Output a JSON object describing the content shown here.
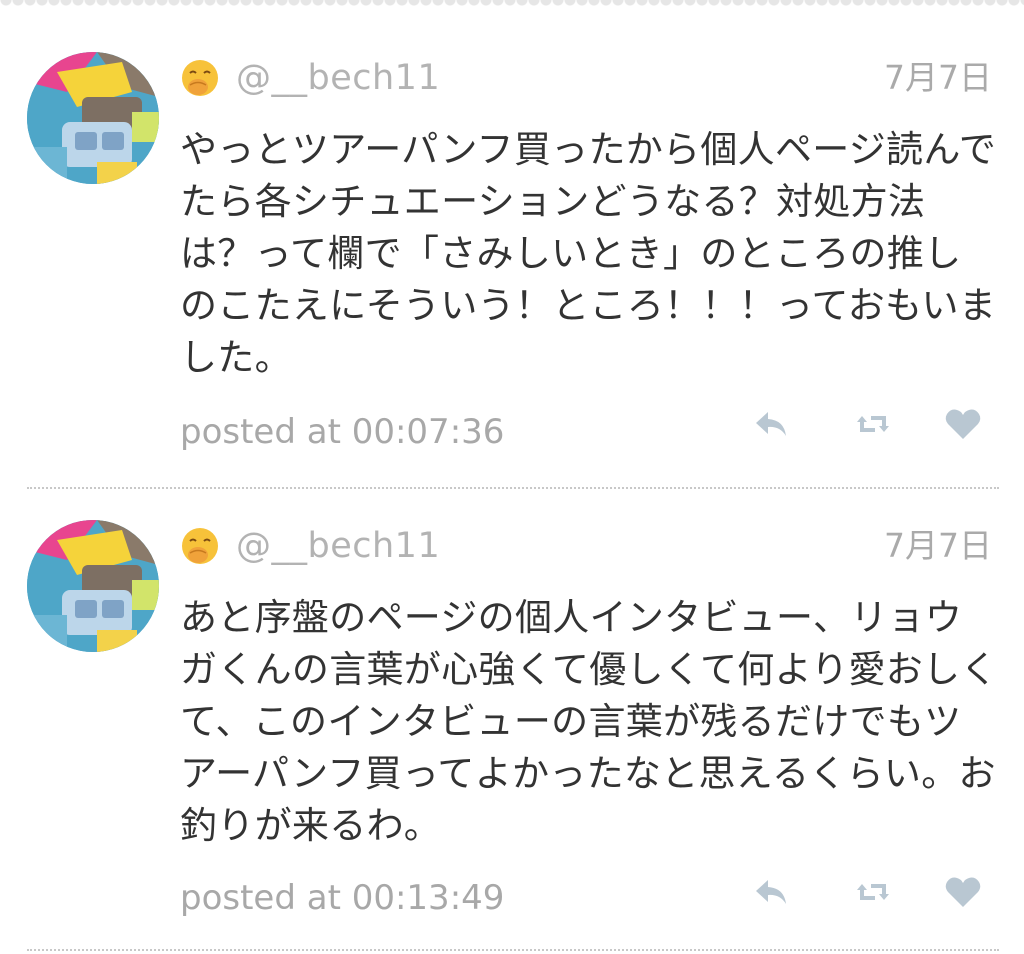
{
  "timeline": {
    "tweets": [
      {
        "handle": "@__bech11",
        "date": "7月7日",
        "text": "やっとツアーパンフ買ったから個人ページ読んでたら各シチュエーションどうなる？対処方法は？って欄で「さみしいとき」のところの推しのこたえにそういう！ところ！！！っておもいました。",
        "posted_at": "posted at 00:07:36"
      },
      {
        "handle": "@__bech11",
        "date": "7月7日",
        "text": "あと序盤のページの個人インタビュー、リョウガくんの言葉が心強くて優しくて何より愛おしくて、このインタビューの言葉が残るだけでもツアーパンフ買ってよかったなと思えるくらい。お釣りが来るわ。",
        "posted_at": "posted at 00:13:49"
      }
    ]
  },
  "icons": {
    "user_emoji": "face-with-hand-over-mouth-icon",
    "reply": "reply-icon",
    "retweet": "retweet-icon",
    "like": "heart-icon"
  },
  "colors": {
    "text": "#333333",
    "muted": "#aaaaaa",
    "action_icon": "#b9c7d2",
    "divider": "#c8c8c8"
  }
}
